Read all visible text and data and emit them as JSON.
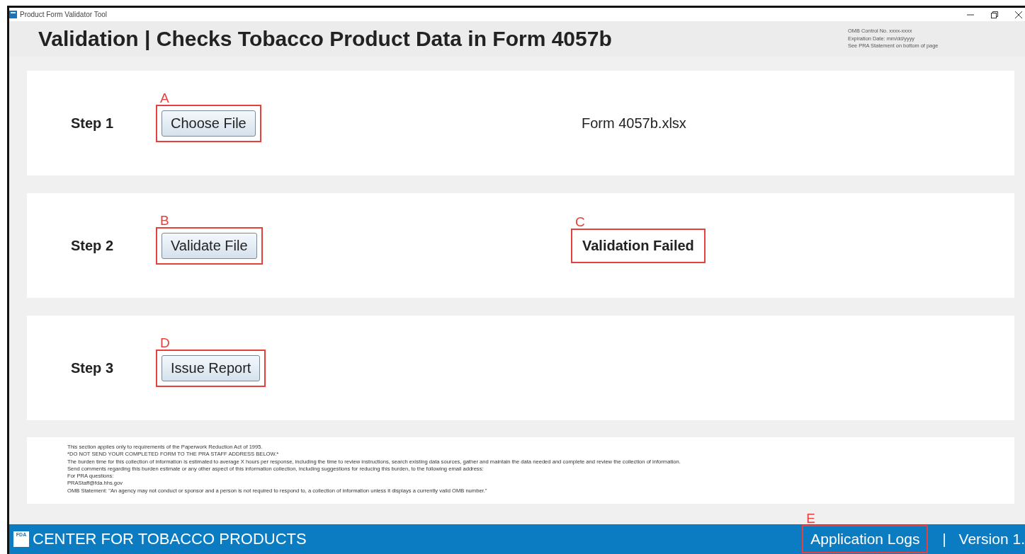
{
  "window": {
    "title": "Product Form Validator Tool"
  },
  "header": {
    "title": "Validation | Checks Tobacco Product Data in Form 4057b",
    "omb_lines": [
      "OMB Control No. xxxx-xxxx",
      "Expiration Date: mm/dd/yyyy",
      "See PRA Statement on bottom of page"
    ]
  },
  "steps": [
    {
      "label": "Step 1",
      "marker": "A",
      "button": "Choose File",
      "status": {
        "kind": "filename",
        "text": "Form 4057b.xlsx"
      }
    },
    {
      "label": "Step 2",
      "marker": "B",
      "button": "Validate File",
      "status": {
        "kind": "result",
        "text": "Validation Failed",
        "marker": "C"
      }
    },
    {
      "label": "Step 3",
      "marker": "D",
      "button": "Issue Report"
    }
  ],
  "pra_statement": [
    "This section applies only to requirements of the Paperwork Reduction Act of 1995.",
    "*DO NOT SEND YOUR COMPLETED FORM TO THE PRA STAFF ADDRESS BELOW.*",
    "The burden time for this collection of information is estimated to average X hours per response, including the time to review instructions, search existing data sources, gather and maintain the data needed and complete and review the collection of information.",
    "Send comments regarding this burden estimate or any other aspect of this information collection, including suggestions for reducing this burden, to the following email address:",
    "For PRA questions:",
    "PRAStaff@fda.hhs.gov",
    "OMB Statement: \"An agency may not conduct or sponsor and a person is not required to respond to, a collection of information unless it displays a currently valid OMB number.\""
  ],
  "footer": {
    "logo": "FDA",
    "title": "CENTER FOR TOBACCO PRODUCTS",
    "link": {
      "label": "Application Logs",
      "marker": "E"
    },
    "separator": "|",
    "version": "Version 1."
  }
}
